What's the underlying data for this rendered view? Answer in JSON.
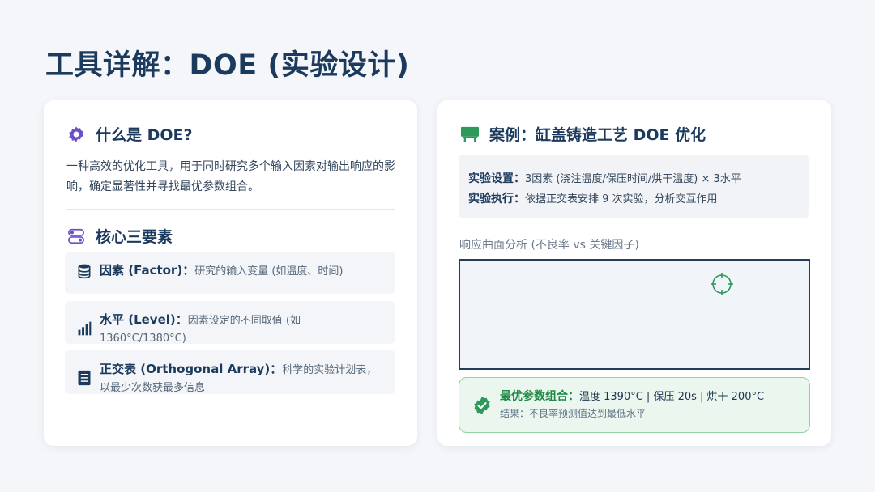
{
  "page": {
    "title": "工具详解：DOE (实验设计)"
  },
  "left": {
    "what": {
      "title": "什么是 DOE?",
      "icon": "gear-icon",
      "description": "一种高效的优化工具，用于同时研究多个输入因素对输出响应的影响，确定显著性并寻找最优参数组合。"
    },
    "core": {
      "title": "核心三要素",
      "icon": "toggle-icon",
      "items": [
        {
          "icon": "database-icon",
          "term": "因素 (Factor)：",
          "desc": "研究的输入变量 (如温度、时间)"
        },
        {
          "icon": "bar-chart-icon",
          "term": "水平 (Level)：",
          "desc": "因素设定的不同取值 (如 1360°C/1380°C)"
        },
        {
          "icon": "list-icon",
          "term": "正交表 (Orthogonal Array)：",
          "desc": "科学的实验计划表，以最少次数获最多信息"
        }
      ]
    }
  },
  "right": {
    "case": {
      "title": "案例：缸盖铸造工艺 DOE 优化",
      "icon": "chalkboard-icon",
      "setup_label": "实验设置：",
      "setup_value": "3因素 (浇注温度/保压时间/烘干温度) × 3水平",
      "exec_label": "实验执行：",
      "exec_value": "依据正交表安排 9 次实验，分析交互作用"
    },
    "chart": {
      "label": "响应曲面分析 (不良率 vs 关键因子)",
      "marker_icon": "crosshair-icon"
    },
    "result": {
      "icon": "check-badge-icon",
      "label": "最优参数组合：",
      "value": "温度 1390°C | 保压 20s | 烘干 200°C",
      "note": "结果：不良率预测值达到最低水平"
    }
  },
  "colors": {
    "primary": "#1c3a5e",
    "accent_purple": "#6b4fc9",
    "accent_green": "#2e9a5a",
    "success_bg": "#eaf6ee"
  }
}
